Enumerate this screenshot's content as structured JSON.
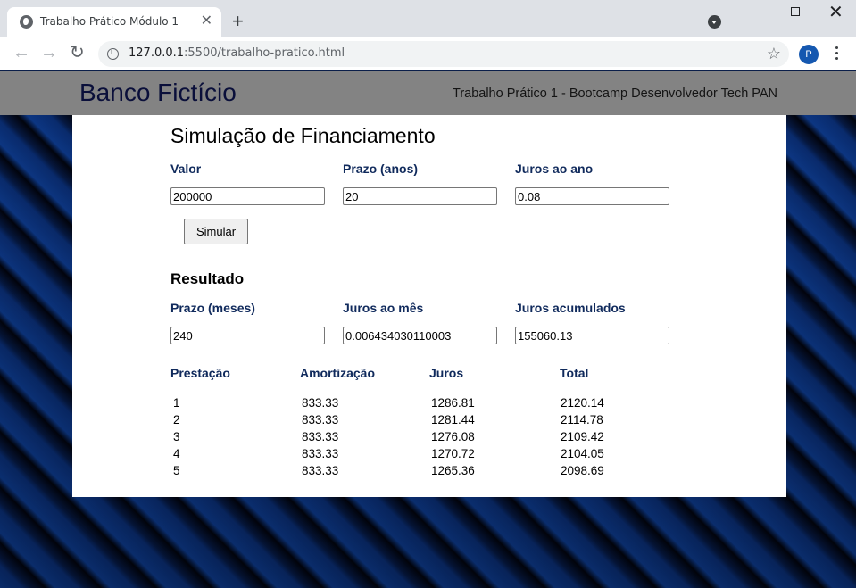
{
  "browser": {
    "tab_title": "Trabalho Prático Módulo 1",
    "url_host": "127.0.0.1",
    "url_rest": ":5500/trabalho-pratico.html",
    "profile_initial": "P"
  },
  "header": {
    "brand": "Banco Fictício",
    "subtitle": "Trabalho Prático 1 - Bootcamp Desenvolvedor Tech PAN"
  },
  "simulation": {
    "title": "Simulação de Financiamento",
    "labels": {
      "valor": "Valor",
      "prazo_anos": "Prazo (anos)",
      "juros_ano": "Juros ao ano"
    },
    "values": {
      "valor": "200000",
      "prazo_anos": "20",
      "juros_ano": "0.08"
    },
    "button": "Simular"
  },
  "result": {
    "title": "Resultado",
    "labels": {
      "prazo_meses": "Prazo (meses)",
      "juros_mes": "Juros ao mês",
      "juros_acumulados": "Juros acumulados"
    },
    "values": {
      "prazo_meses": "240",
      "juros_mes": "0.006434030110003",
      "juros_acumulados": "155060.13"
    }
  },
  "table": {
    "headers": [
      "Prestação",
      "Amortização",
      "Juros",
      "Total"
    ],
    "rows": [
      [
        "1",
        "833.33",
        "1286.81",
        "2120.14"
      ],
      [
        "2",
        "833.33",
        "1281.44",
        "2114.78"
      ],
      [
        "3",
        "833.33",
        "1276.08",
        "2109.42"
      ],
      [
        "4",
        "833.33",
        "1270.72",
        "2104.05"
      ],
      [
        "5",
        "833.33",
        "1265.36",
        "2098.69"
      ]
    ]
  },
  "colors": {
    "header_bg": "#838383",
    "label": "#102a5c",
    "brand": "#0a0f3a"
  }
}
